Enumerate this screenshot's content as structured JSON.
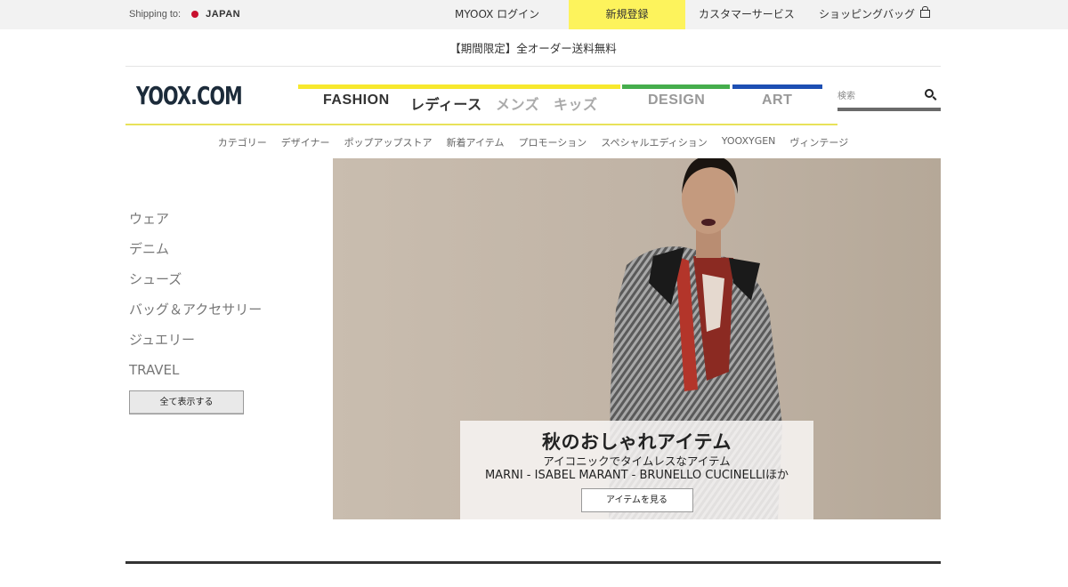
{
  "topbar": {
    "shipping_label": "Shipping to:",
    "country": "JAPAN",
    "login": "MYOOX ログイン",
    "register": "新規登録",
    "service": "カスタマーサービス",
    "bag": "ショッピングバッグ"
  },
  "promo": "【期間限定】全オーダー送料無料",
  "header": {
    "logo": "YOOX.COM",
    "nav": {
      "fashion": "FASHION",
      "ladies": "レディース",
      "mens": "メンズ",
      "kids": "キッズ",
      "design": "DESIGN",
      "art": "ART"
    },
    "search_placeholder": "検索"
  },
  "subnav": [
    "カテゴリー",
    "デザイナー",
    "ポップアップストア",
    "新着アイテム",
    "プロモーション",
    "スペシャルエディション",
    "YOOXYGEN",
    "ヴィンテージ"
  ],
  "categories": [
    "ウェア",
    "デニム",
    "シューズ",
    "バッグ＆アクセサリー",
    "ジュエリー",
    "TRAVEL"
  ],
  "show_all": "全て表示する",
  "hero": {
    "title": "秋のおしゃれアイテム",
    "subtitle": "アイコニックでタイムレスなアイテム",
    "brands": "MARNI - ISABEL MARANT - BRUNELLO CUCINELLIほか",
    "button": "アイテムを見る"
  },
  "colors": {
    "fashion": "#f7e82d",
    "design": "#45ad4c",
    "art": "#1d4fb3",
    "register_bg": "#fdf35c"
  }
}
